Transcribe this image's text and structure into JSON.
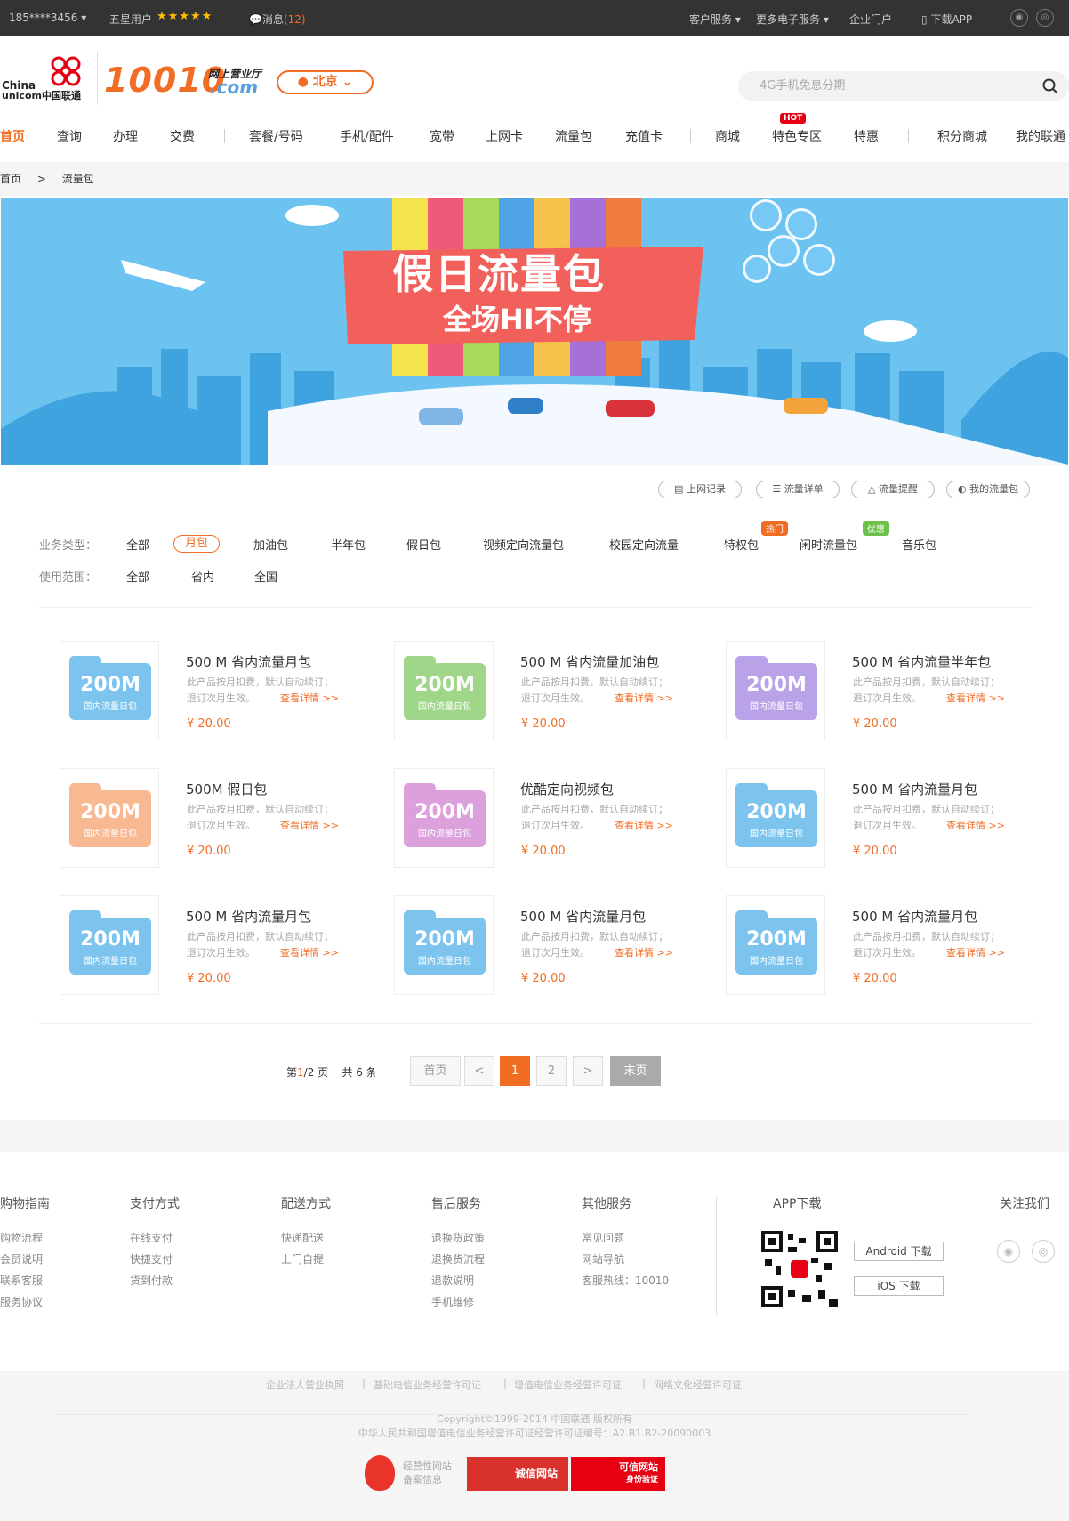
{
  "topbar": {
    "phone": "185****3456",
    "user_level": "五星用户",
    "stars": "★★★★★",
    "messages": "消息",
    "message_count": "(12)",
    "customer_service": "客户服务",
    "more_services": "更多电子服务",
    "enterprise": "企业门户",
    "download_app": "下载APP"
  },
  "header": {
    "logo_china": "China",
    "logo_unicom": "unicom中国联通",
    "logo_number": "10010",
    "logo_sub": "网上营业厅",
    "logo_com": ".com",
    "city": "北京",
    "search_placeholder": "4G手机免息分期"
  },
  "nav": {
    "items": [
      "首页",
      "查询",
      "办理",
      "交费",
      "套餐/号码",
      "手机/配件",
      "宽带",
      "上网卡",
      "流量包",
      "充值卡",
      "商城",
      "特色专区",
      "特惠",
      "积分商城",
      "我的联通"
    ],
    "hot_badge": "HOT"
  },
  "breadcrumb": {
    "home": "首页",
    "sep": ">",
    "current": "流量包"
  },
  "banner": {
    "title": "假日流量包",
    "subtitle": "全场HI不停"
  },
  "tools": [
    "上网记录",
    "流量详单",
    "流量提醒",
    "我的流量包"
  ],
  "filters": {
    "type_label": "业务类型：",
    "types": [
      "全部",
      "月包",
      "加油包",
      "半年包",
      "假日包",
      "视频定向流量包",
      "校园定向流量",
      "特权包",
      "闲时流量包",
      "音乐包"
    ],
    "hot_tag": "热门",
    "promo_tag": "优惠",
    "scope_label": "使用范围：",
    "scopes": [
      "全部",
      "省内",
      "全国"
    ]
  },
  "products": [
    {
      "name": "500 M  省内流量月包",
      "big": "200M",
      "small": "国内流量日包",
      "desc1": "此产品按月扣费，默认自动续订；",
      "desc2": "退订次月生效。",
      "link": "查看详情 >>",
      "price": "¥ 20.00",
      "color": "#7cc4ee"
    },
    {
      "name": "500 M  省内流量加油包",
      "big": "200M",
      "small": "国内流量日包",
      "desc1": "此产品按月扣费，默认自动续订；",
      "desc2": "退订次月生效。",
      "link": "查看详情 >>",
      "price": "¥ 20.00",
      "color": "#9fd68a"
    },
    {
      "name": "500 M  省内流量半年包",
      "big": "200M",
      "small": "国内流量日包",
      "desc1": "此产品按月扣费，默认自动续订；",
      "desc2": "退订次月生效。",
      "link": "查看详情 >>",
      "price": "¥ 20.00",
      "color": "#b9a2e8"
    },
    {
      "name": "500M 假日包",
      "big": "200M",
      "small": "国内流量日包",
      "desc1": "此产品按月扣费，默认自动续订；",
      "desc2": "退订次月生效。",
      "link": "查看详情 >>",
      "price": "¥ 20.00",
      "color": "#f8b892"
    },
    {
      "name": "优酷定向视频包",
      "big": "200M",
      "small": "国内流量日包",
      "desc1": "此产品按月扣费，默认自动续订；",
      "desc2": "退订次月生效。",
      "link": "查看详情 >>",
      "price": "¥ 20.00",
      "color": "#dca0dc"
    },
    {
      "name": "500 M  省内流量月包",
      "big": "200M",
      "small": "国内流量日包",
      "desc1": "此产品按月扣费，默认自动续订；",
      "desc2": "退订次月生效。",
      "link": "查看详情 >>",
      "price": "¥ 20.00",
      "color": "#7cc4ee"
    },
    {
      "name": "500 M  省内流量月包",
      "big": "200M",
      "small": "国内流量日包",
      "desc1": "此产品按月扣费，默认自动续订；",
      "desc2": "退订次月生效。",
      "link": "查看详情 >>",
      "price": "¥ 20.00",
      "color": "#7cc4ee"
    },
    {
      "name": "500 M  省内流量月包",
      "big": "200M",
      "small": "国内流量日包",
      "desc1": "此产品按月扣费，默认自动续订；",
      "desc2": "退订次月生效。",
      "link": "查看详情 >>",
      "price": "¥ 20.00",
      "color": "#7cc4ee"
    },
    {
      "name": "500 M  省内流量月包",
      "big": "200M",
      "small": "国内流量日包",
      "desc1": "此产品按月扣费，默认自动续订；",
      "desc2": "退订次月生效。",
      "link": "查看详情 >>",
      "price": "¥ 20.00",
      "color": "#7cc4ee"
    }
  ],
  "pagination": {
    "info_prefix": "第",
    "current_page": "1",
    "info_total": "/2 页",
    "count": "共 6 条",
    "first": "首页",
    "prev": "<",
    "pages": [
      "1",
      "2"
    ],
    "next": ">",
    "last": "末页"
  },
  "footer": {
    "columns": [
      {
        "title": "购物指南",
        "links": [
          "购物流程",
          "会员说明",
          "联系客服",
          "服务协议"
        ]
      },
      {
        "title": "支付方式",
        "links": [
          "在线支付",
          "快捷支付",
          "货到付款"
        ]
      },
      {
        "title": "配送方式",
        "links": [
          "快递配送",
          "上门自提"
        ]
      },
      {
        "title": "售后服务",
        "links": [
          "退换货政策",
          "退换货流程",
          "退款说明",
          "手机维修"
        ]
      },
      {
        "title": "其他服务",
        "links": [
          "常见问题",
          "网站导航",
          "客服热线：10010"
        ]
      }
    ],
    "app_title": "APP下载",
    "android": "Android 下载",
    "ios": "iOS 下载",
    "follow": "关注我们"
  },
  "bottom": {
    "licenses": [
      "企业法人营业执照",
      "基础电信业务经营许可证",
      "增值电信业务经营许可证",
      "网络文化经营许可证"
    ],
    "copyright": "Copyright©1999-2014  中国联通 版权所有",
    "icp": "中华人民共和国增值电信业务经营许可证经营许可证编号：A2.B1.B2-20090003",
    "badge1_line1": "经营性网站",
    "badge1_line2": "备案信息",
    "badge2": "诚信网站",
    "badge3_line1": "可信网站",
    "badge3_line2": "身份验证"
  }
}
